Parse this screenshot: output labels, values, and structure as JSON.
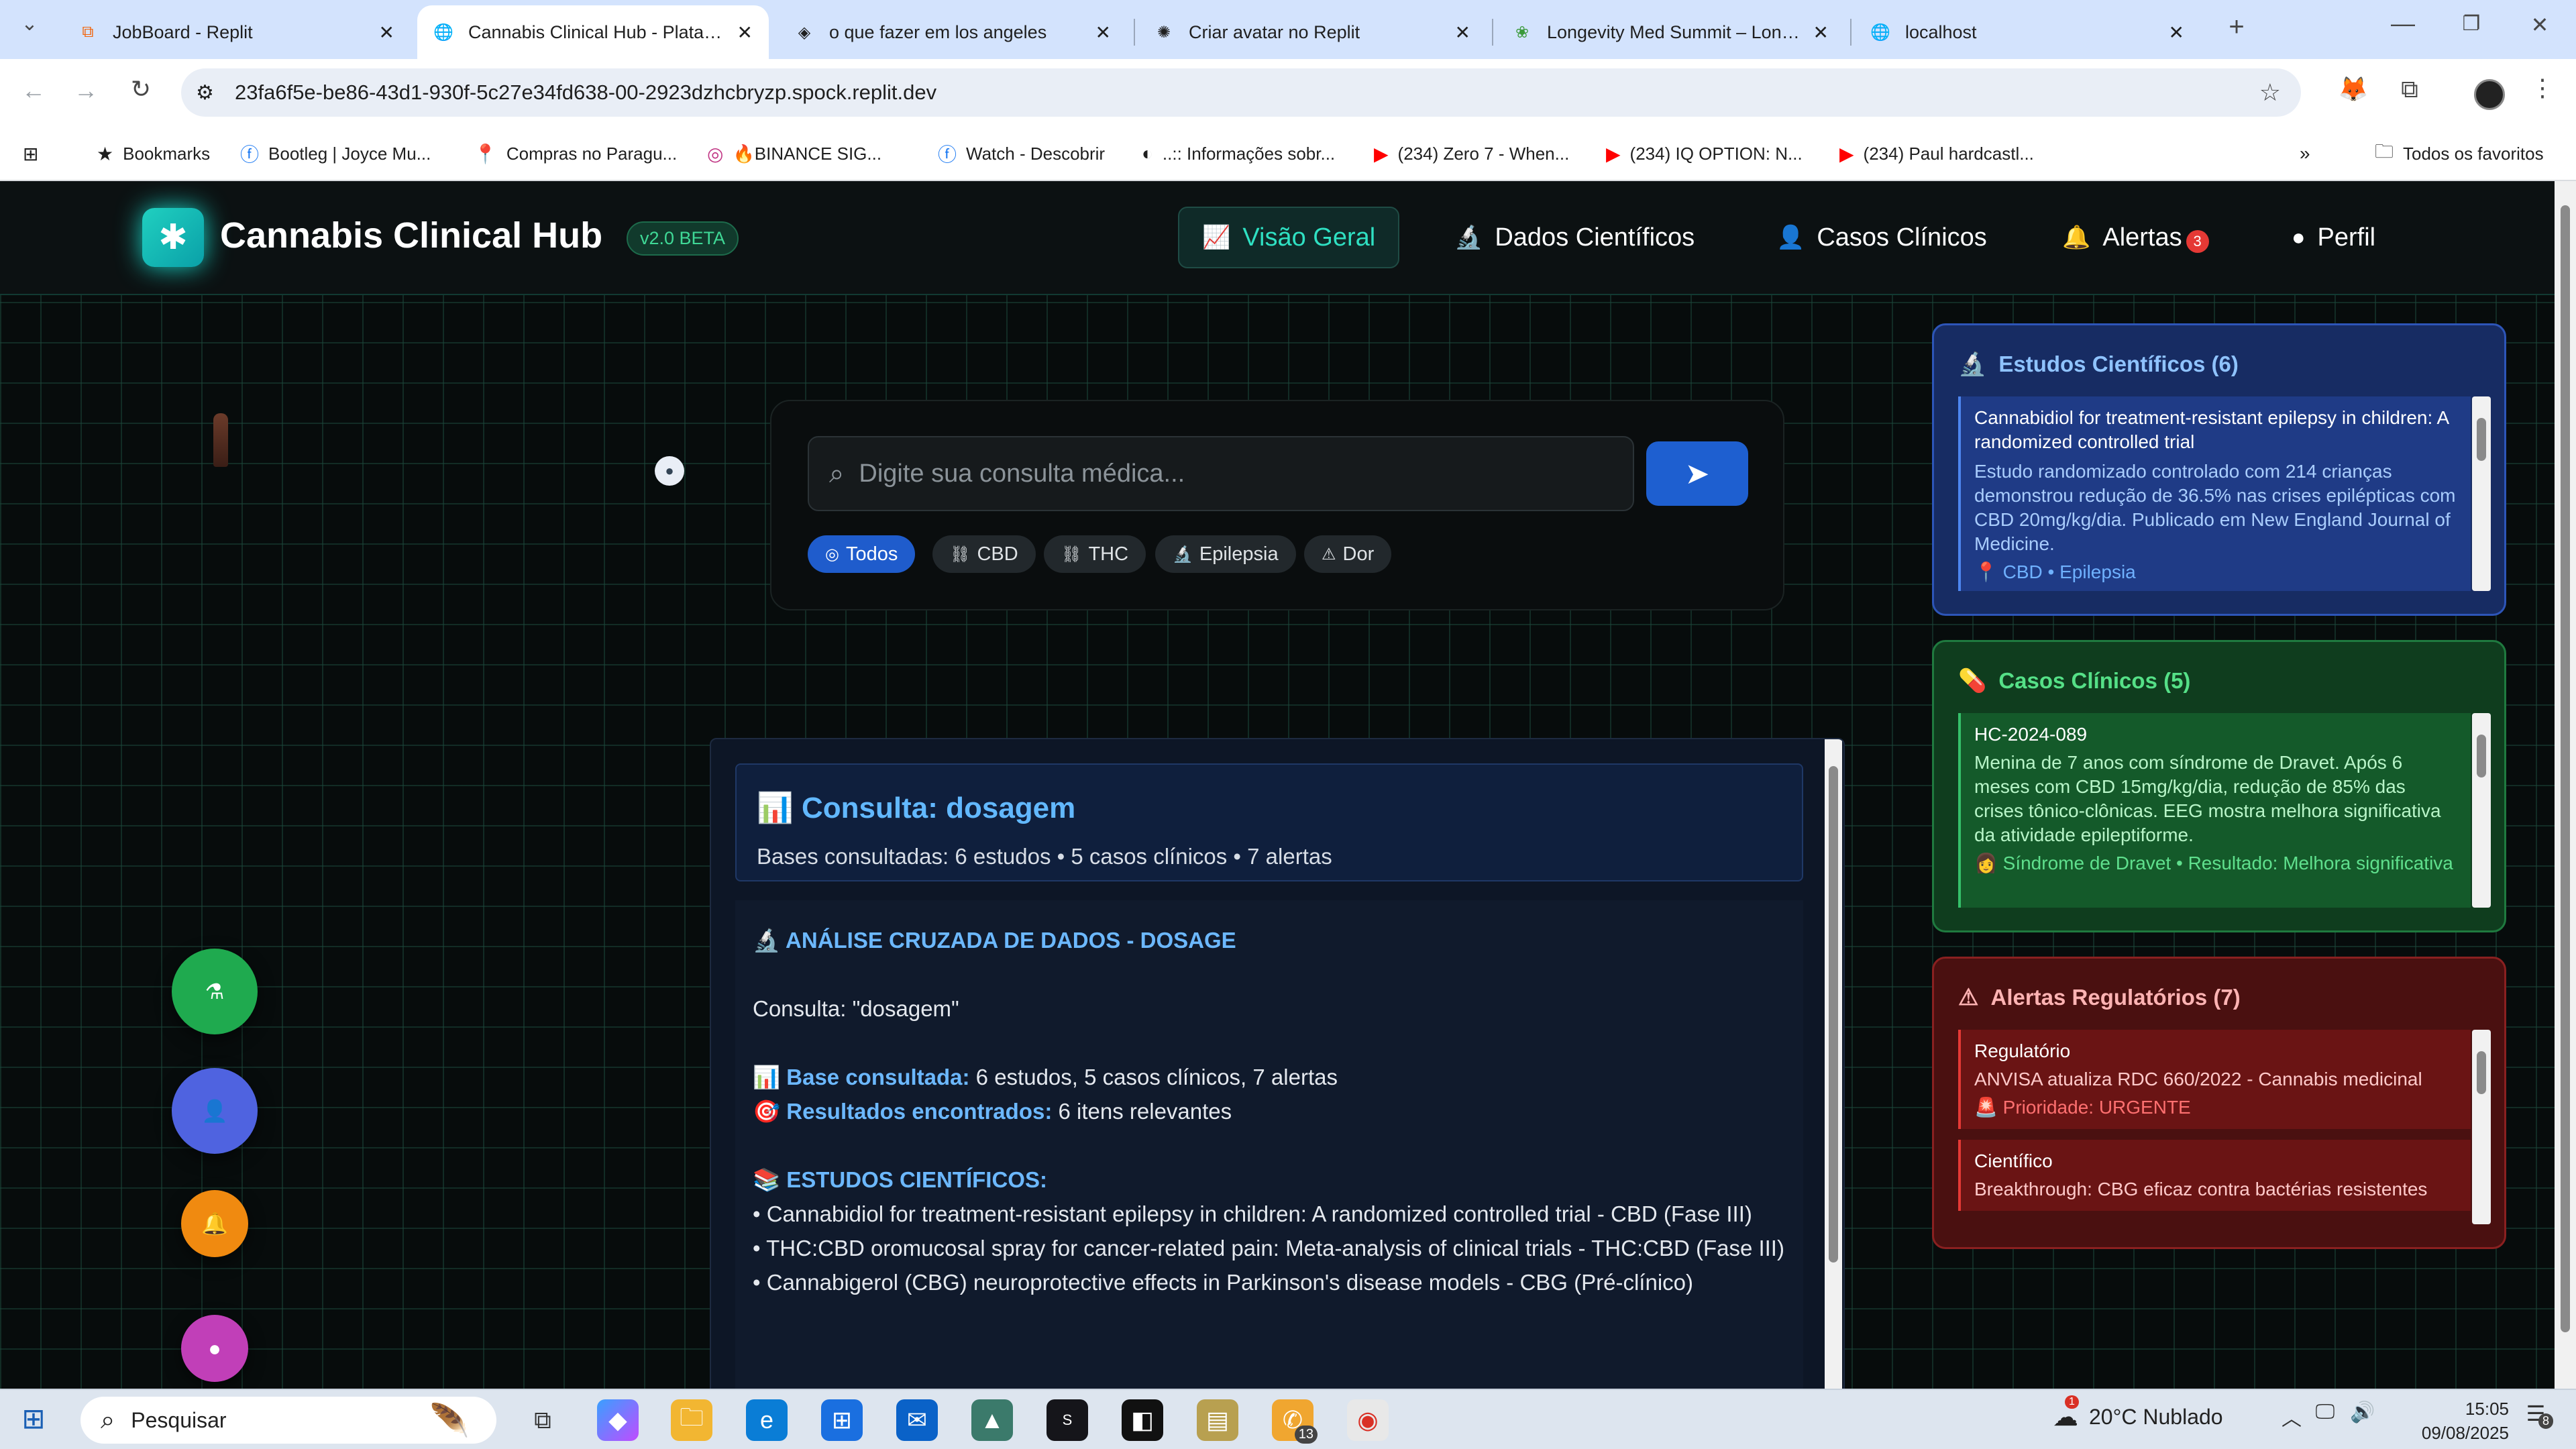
{
  "browser": {
    "tabs": [
      {
        "title": "JobBoard - Replit",
        "icon": "replit-icon"
      },
      {
        "title": "Cannabis Clinical Hub - Platafor",
        "icon": "globe-icon"
      },
      {
        "title": "o que fazer em los angeles",
        "icon": "ai-icon"
      },
      {
        "title": "Criar avatar no Replit",
        "icon": "openai-icon"
      },
      {
        "title": "Longevity Med Summit – Longe",
        "icon": "tree-icon"
      },
      {
        "title": "localhost",
        "icon": "globe-icon"
      }
    ],
    "url": "23fa6f5e-be86-43d1-930f-5c27e34fd638-00-2923dzhcbryzp.spock.replit.dev",
    "bookmarks": [
      {
        "label": "Bookmarks",
        "icon": "star-icon"
      },
      {
        "label": "Bootleg | Joyce Mu...",
        "icon": "facebook-icon"
      },
      {
        "label": "Compras no Paragu...",
        "icon": "pin-icon"
      },
      {
        "label": "🔥BINANCE SIG...",
        "icon": "instagram-icon"
      },
      {
        "label": "Watch - Descobrir",
        "icon": "facebook-icon"
      },
      {
        "label": "..:: Informações sobr...",
        "icon": "globe-icon"
      },
      {
        "label": "(234) Zero 7 - When...",
        "icon": "youtube-icon"
      },
      {
        "label": "(234) IQ OPTION: N...",
        "icon": "youtube-icon"
      },
      {
        "label": "(234) Paul hardcastl...",
        "icon": "youtube-icon"
      }
    ],
    "all_bookmarks": "Todos os favoritos"
  },
  "app": {
    "title": "Cannabis Clinical Hub",
    "version": "v2.0 BETA",
    "nav": [
      {
        "label": "Visão Geral",
        "icon": "chart-line-icon"
      },
      {
        "label": "Dados Científicos",
        "icon": "microscope-icon"
      },
      {
        "label": "Casos Clínicos",
        "icon": "doctor-icon"
      },
      {
        "label": "Alertas",
        "icon": "bell-icon"
      },
      {
        "label": "Perfil",
        "icon": "user-circle-icon"
      }
    ],
    "alert_count": "3"
  },
  "search": {
    "placeholder": "Digite sua consulta médica...",
    "chips": [
      {
        "label": "Todos",
        "icon": "globe-icon",
        "active": true
      },
      {
        "label": "CBD",
        "icon": "link-icon"
      },
      {
        "label": "THC",
        "icon": "link-icon"
      },
      {
        "label": "Epilepsia",
        "icon": "microscope-icon"
      },
      {
        "label": "Dor",
        "icon": "warning-icon"
      }
    ]
  },
  "result": {
    "title": "📊 Consulta: dosagem",
    "subtitle": "Bases consultadas: 6 estudos • 5 casos clínicos • 7 alertas",
    "section_heading": "🔬 ANÁLISE CRUZADA DE DADOS - DOSAGE",
    "query_line": "Consulta: \"dosagem\"",
    "base_label": "📊 Base consultada:",
    "base_value": " 6 estudos, 5 casos clínicos, 7 alertas",
    "found_label": "🎯 Resultados encontrados:",
    "found_value": " 6 itens relevantes",
    "studies_heading": "📚 ESTUDOS CIENTÍFICOS:",
    "studies": [
      "• Cannabidiol for treatment-resistant epilepsy in children: A randomized controlled trial - CBD (Fase III)",
      "• THC:CBD oromucosal spray for cancer-related pain: Meta-analysis of clinical trials - THC:CBD (Fase III)",
      "• Cannabigerol (CBG) neuroprotective effects in Parkinson's disease models - CBG (Pré-clínico)"
    ]
  },
  "panels": {
    "studies": {
      "title": "Estudos Científicos (6)",
      "item_title": "Cannabidiol for treatment-resistant epilepsy in children: A randomized controlled trial",
      "item_desc": "Estudo randomizado controlado com 214 crianças demonstrou redução de 36.5% nas crises epilépticas com CBD 20mg/kg/dia. Publicado em New England Journal of Medicine.",
      "item_tags": "📍 CBD • Epilepsia"
    },
    "cases": {
      "title": "Casos Clínicos (5)",
      "item_id": "HC-2024-089",
      "item_desc": "Menina de 7 anos com síndrome de Dravet. Após 6 meses com CBD 15mg/kg/dia, redução de 85% das crises tônico-clônicas. EEG mostra melhora significativa da atividade epileptiforme.",
      "item_tags": "👩 Síndrome de Dravet • Resultado: Melhora significativa"
    },
    "alerts": {
      "title": "Alertas Regulatórios (7)",
      "items": [
        {
          "category": "Regulatório",
          "text": "ANVISA atualiza RDC 660/2022 - Cannabis medicinal",
          "priority": "🚨 Prioridade: URGENTE"
        },
        {
          "category": "Científico",
          "text": "Breakthrough: CBG eficaz contra bactérias resistentes",
          "priority": ""
        }
      ]
    }
  },
  "taskbar": {
    "search_placeholder": "Pesquisar",
    "weather": "20°C Nublado",
    "time": "15:05",
    "date": "09/08/2025",
    "whatsapp_badge": "13",
    "notification_badge": "8",
    "weather_badge": "1"
  },
  "colors": {
    "accent": "#2fe0c2",
    "studies_panel": "#172c63",
    "cases_panel": "#0f3d1e",
    "alerts_panel": "#4a1010"
  }
}
